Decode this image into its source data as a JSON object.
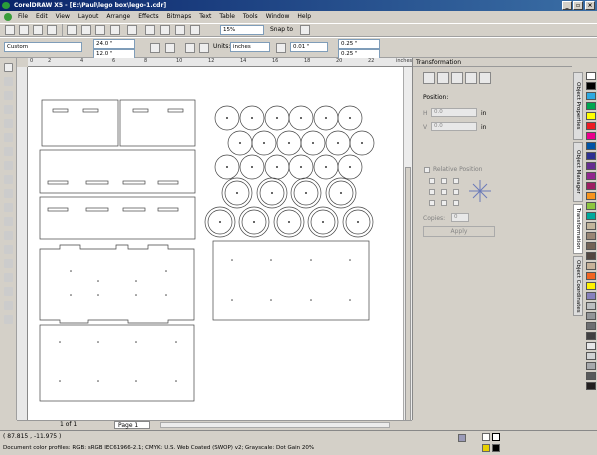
{
  "window": {
    "title": "CorelDRAW X5 - [E:\\Paul\\lego box\\lego-1.cdr]",
    "controls": [
      "_",
      "▫",
      "×"
    ]
  },
  "menu": [
    "File",
    "Edit",
    "View",
    "Layout",
    "Arrange",
    "Effects",
    "Bitmaps",
    "Text",
    "Table",
    "Tools",
    "Window",
    "Help"
  ],
  "toolbar": {
    "zoom": "15%",
    "snap": "Snap to"
  },
  "propbar": {
    "page_size": "Custom",
    "width": "24.0 \"",
    "height": "12.0 \"",
    "units_label": "Units:",
    "units": "inches",
    "nudge": "0.01 \"",
    "dup_x": "0.25 \"",
    "dup_y": "0.25 \""
  },
  "ruler": {
    "unit": "inches",
    "ticks": [
      "0",
      "2",
      "4",
      "6",
      "8",
      "10",
      "12",
      "14",
      "16",
      "18",
      "20",
      "22"
    ]
  },
  "docker": {
    "title": "Transformation",
    "position_label": "Position:",
    "x": "0.0",
    "y": "0.0",
    "unit": "in",
    "relative_position": "Relative Position",
    "copies_label": "Copies:",
    "copies": "0",
    "apply": "Apply"
  },
  "side_tabs": [
    "Object Properties",
    "Object Manager",
    "Transformation",
    "Object Coordinates"
  ],
  "colors": {
    "palette": [
      "#ffffff",
      "#000000",
      "#2ea9e0",
      "#00a651",
      "#ffff00",
      "#ed1c24",
      "#ec008c",
      "#0054a6",
      "#2e3192",
      "#662d91",
      "#92278f",
      "#9e1f63",
      "#f7941d",
      "#8dc63f",
      "#00a99d",
      "#c2b59b",
      "#998675",
      "#736357",
      "#534741",
      "#c7b299",
      "#f26522",
      "#fff200",
      "#8781bd",
      "#bcbec0",
      "#939598",
      "#6d6e71",
      "#414042",
      "#e6e7e8",
      "#d1d3d4",
      "#a7a9ac",
      "#58595b",
      "#231f20"
    ]
  },
  "pager": {
    "info": "1 of 1",
    "tab": "Page 1"
  },
  "status": {
    "coords": "( 87.815 , -11.975 )",
    "profile": "Document color profiles: RGB: sRGB IEC61966-2.1; CMYK: U.S. Web Coated (SWOP) v2; Grayscale: Dot Gain 20%"
  }
}
